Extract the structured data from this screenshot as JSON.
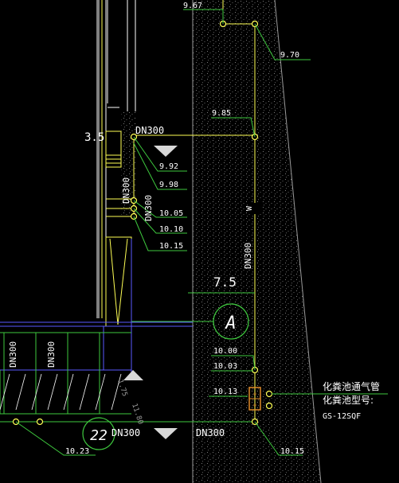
{
  "colors": {
    "background": "#000000",
    "yellow": "#ffff55",
    "green": "#3ec83e",
    "blue": "#5a5aff",
    "white": "#ffffff",
    "gray": "#9a9a9a",
    "orange": "#e08a28"
  },
  "elevations": {
    "e967": "9.67",
    "e970": "9.70",
    "e985": "9.85",
    "e992": "9.92",
    "e998": "9.98",
    "e1005": "10.05",
    "e1010": "10.10",
    "e1015_left": "10.15",
    "e1000": "10.00",
    "e1003": "10.03",
    "e1013": "10.13",
    "e1023": "10.23",
    "e1015_bottom": "10.15"
  },
  "dimensions": {
    "d35": "3.5",
    "d75": "7.5"
  },
  "pipes": {
    "dn300_top": "DN300",
    "dn300_vertical_left": "DN300",
    "dn300_small": "DN300",
    "dn300_vertical_right": "DN300",
    "dn300_bottom_left": "DN300",
    "dn300_bottom_right": "DN300",
    "dn300_far_left_1": "DN300",
    "dn300_far_left_2": "DN300"
  },
  "markers": {
    "section_a": "A",
    "node_22": "22",
    "w_mark": "W"
  },
  "slope_labels": {
    "s175": "1.75",
    "s1180": "11.80"
  },
  "septic": {
    "line1": "化粪池通气管",
    "line2": "化粪池型号:",
    "line3": "GS-12SQF"
  }
}
